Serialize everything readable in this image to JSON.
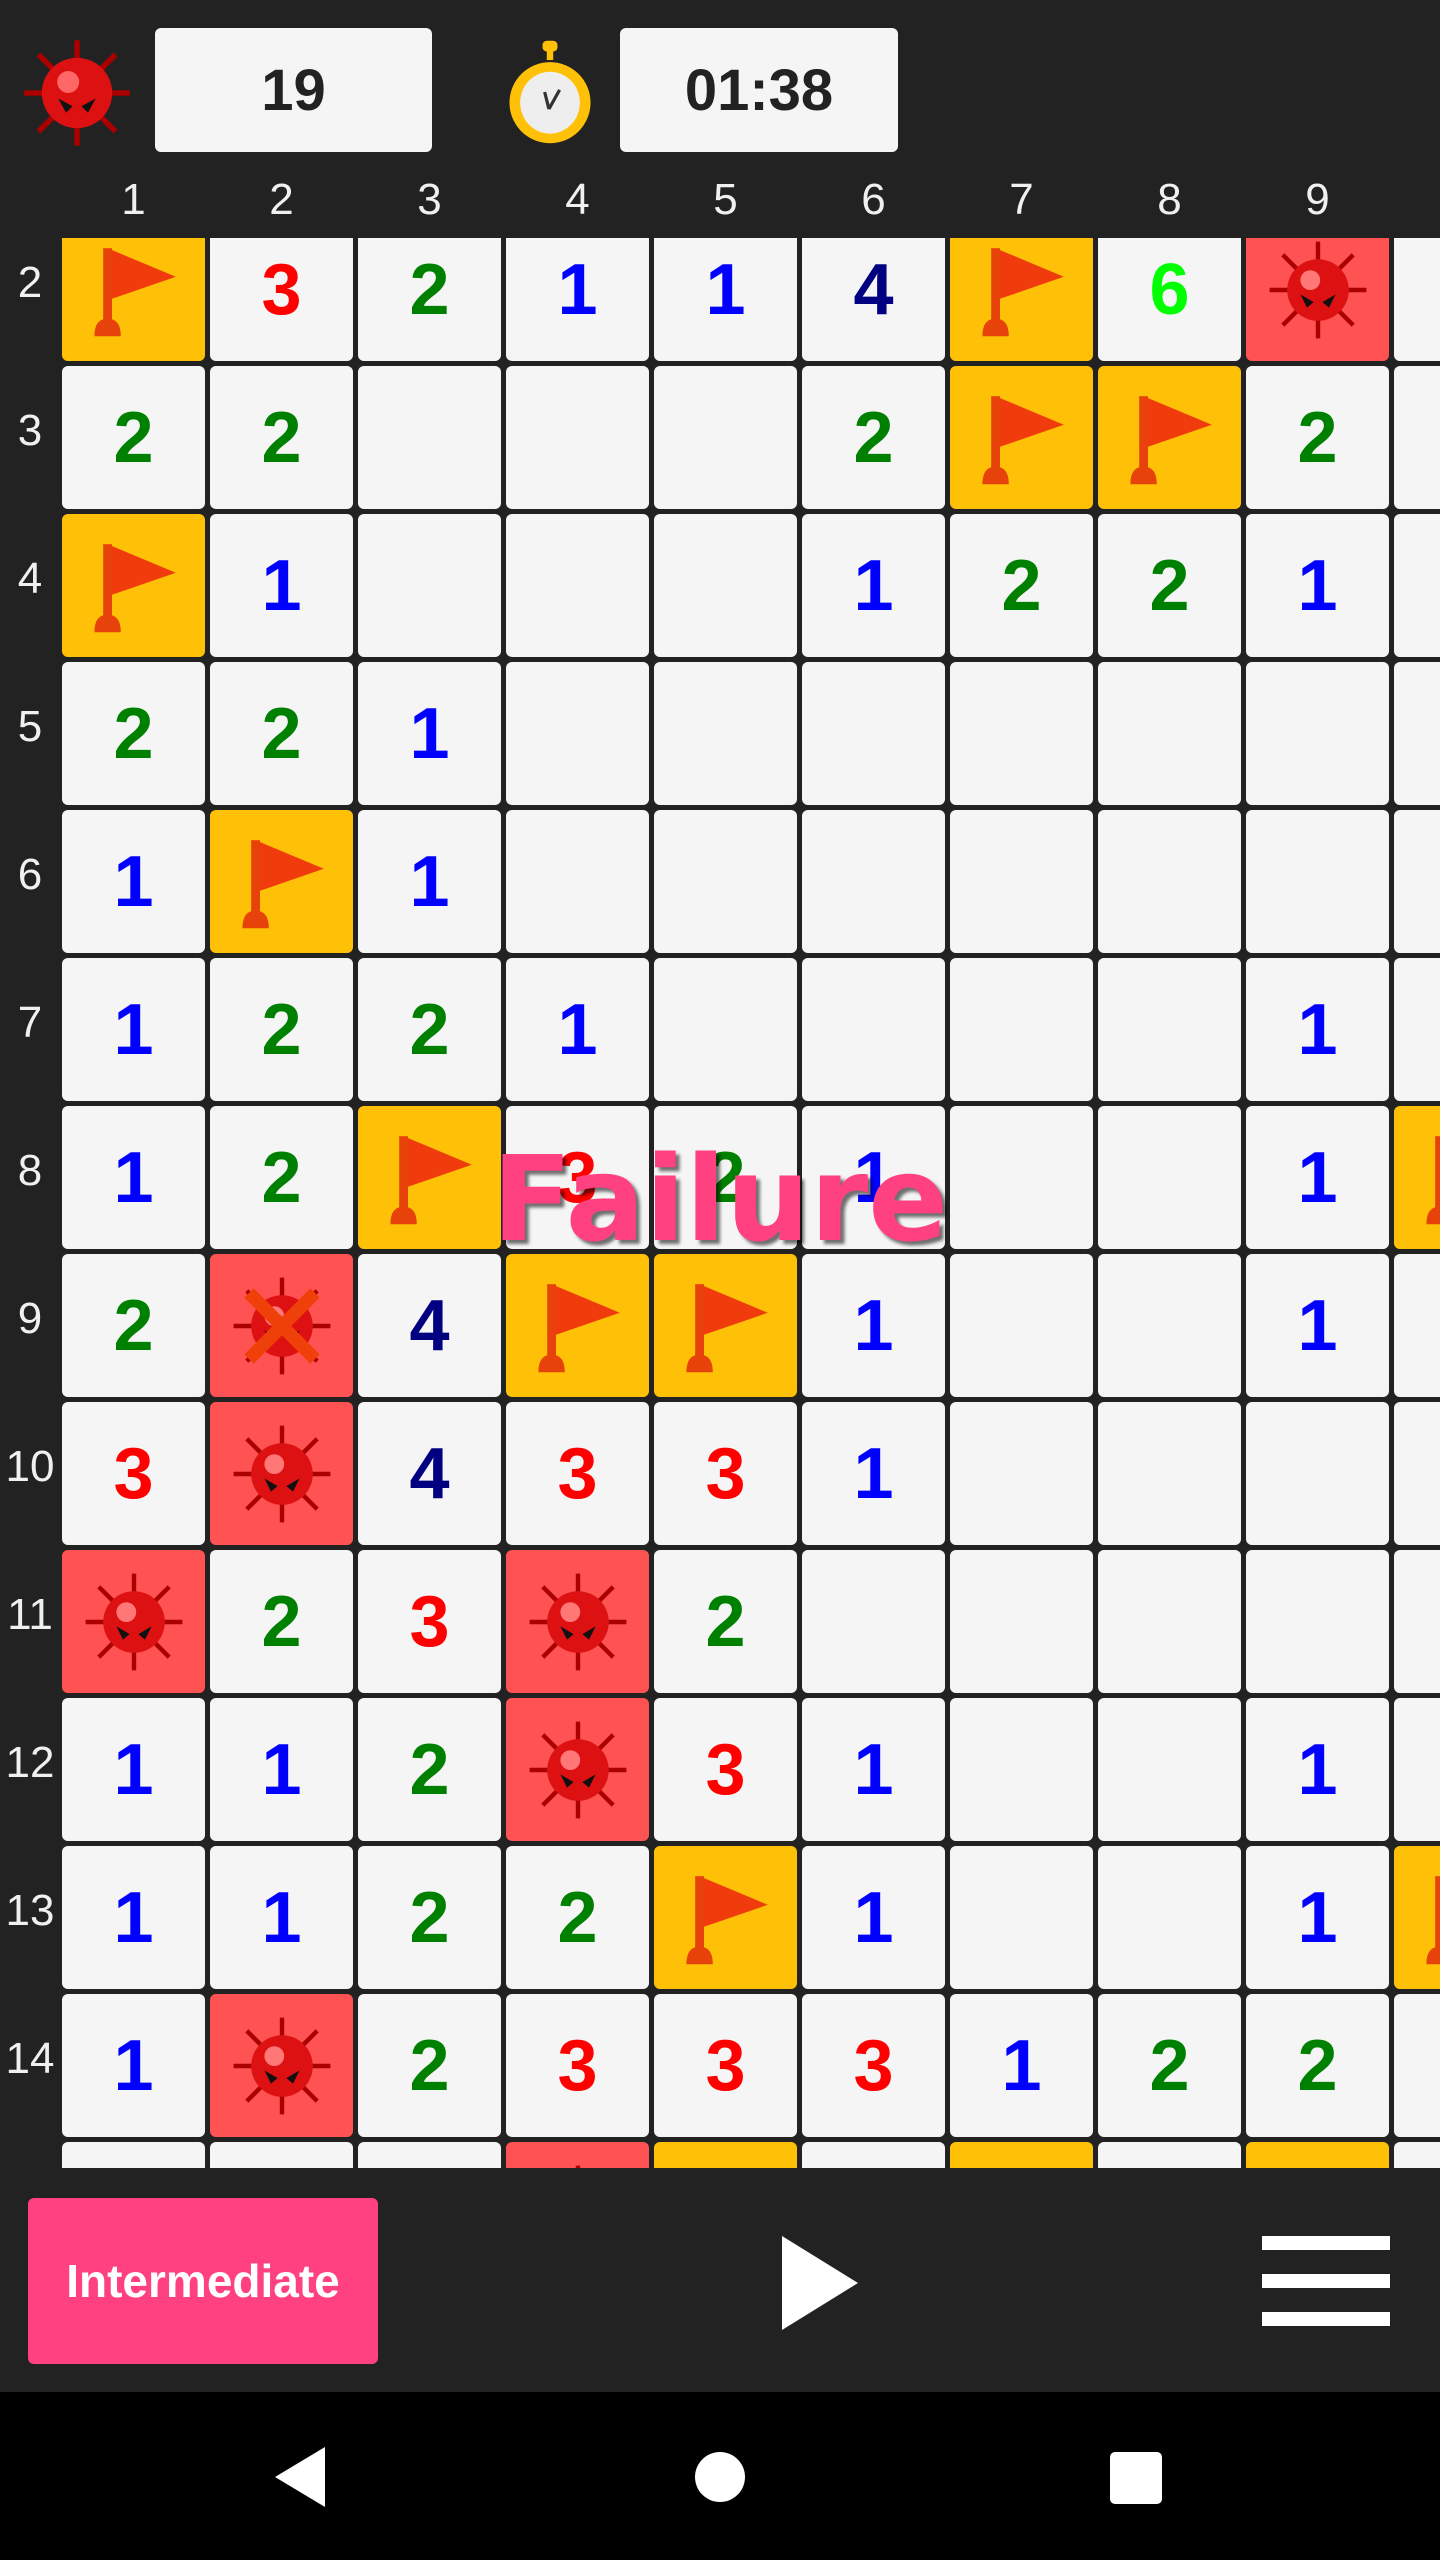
{
  "header": {
    "mine_counter": "19",
    "timer": "01:38",
    "mine_icon": "mine-icon",
    "timer_icon": "stopwatch-icon"
  },
  "columns": [
    "1",
    "2",
    "3",
    "4",
    "5",
    "6",
    "7",
    "8",
    "9"
  ],
  "rows": [
    {
      "label": "2",
      "cells": [
        "F",
        "3",
        "2",
        "1",
        "1",
        "4",
        "F",
        "6",
        "M",
        ""
      ]
    },
    {
      "label": "3",
      "cells": [
        "2",
        "2",
        "",
        "",
        "",
        "2",
        "F",
        "F",
        "2",
        ""
      ]
    },
    {
      "label": "4",
      "cells": [
        "F",
        "1",
        "",
        "",
        "",
        "1",
        "2",
        "2",
        "1",
        ""
      ]
    },
    {
      "label": "5",
      "cells": [
        "2",
        "2",
        "1",
        "",
        "",
        "",
        "",
        "",
        "",
        ""
      ]
    },
    {
      "label": "6",
      "cells": [
        "1",
        "F",
        "1",
        "",
        "",
        "",
        "",
        "",
        "",
        ""
      ]
    },
    {
      "label": "7",
      "cells": [
        "1",
        "2",
        "2",
        "1",
        "",
        "",
        "",
        "",
        "1",
        ""
      ]
    },
    {
      "label": "8",
      "cells": [
        "1",
        "2",
        "F",
        "3",
        "2",
        "1",
        "",
        "",
        "1",
        "F"
      ]
    },
    {
      "label": "9",
      "cells": [
        "2",
        "X",
        "4",
        "F",
        "F",
        "1",
        "",
        "",
        "1",
        ""
      ]
    },
    {
      "label": "10",
      "cells": [
        "3",
        "M",
        "4",
        "3",
        "3",
        "1",
        "",
        "",
        "",
        ""
      ]
    },
    {
      "label": "11",
      "cells": [
        "M",
        "2",
        "3",
        "M",
        "2",
        "",
        "",
        "",
        "",
        ""
      ]
    },
    {
      "label": "12",
      "cells": [
        "1",
        "1",
        "2",
        "M",
        "3",
        "1",
        "",
        "",
        "1",
        ""
      ]
    },
    {
      "label": "13",
      "cells": [
        "1",
        "1",
        "2",
        "2",
        "F",
        "1",
        "",
        "",
        "1",
        "F"
      ]
    },
    {
      "label": "14",
      "cells": [
        "1",
        "M",
        "2",
        "3",
        "3",
        "3",
        "1",
        "2",
        "2",
        ""
      ]
    },
    {
      "label": "",
      "cells": [
        "",
        "",
        "",
        "M",
        "F",
        "",
        "F",
        "",
        "F",
        ""
      ]
    }
  ],
  "number_colors": {
    "1": "#0000ff",
    "2": "#008000",
    "3": "#ff0000",
    "4": "#000080",
    "6": "#00ff00"
  },
  "status_message": "Failure",
  "footer": {
    "level_label": "Intermediate",
    "play_icon": "play-icon",
    "menu_icon": "menu-icon"
  },
  "navigation": {
    "back_icon": "back-icon",
    "home_icon": "home-icon",
    "recents_icon": "recents-icon"
  },
  "colors": {
    "flag_bg": "#ffc107",
    "mine_bg": "#ff5252",
    "accent": "#ff4081"
  }
}
